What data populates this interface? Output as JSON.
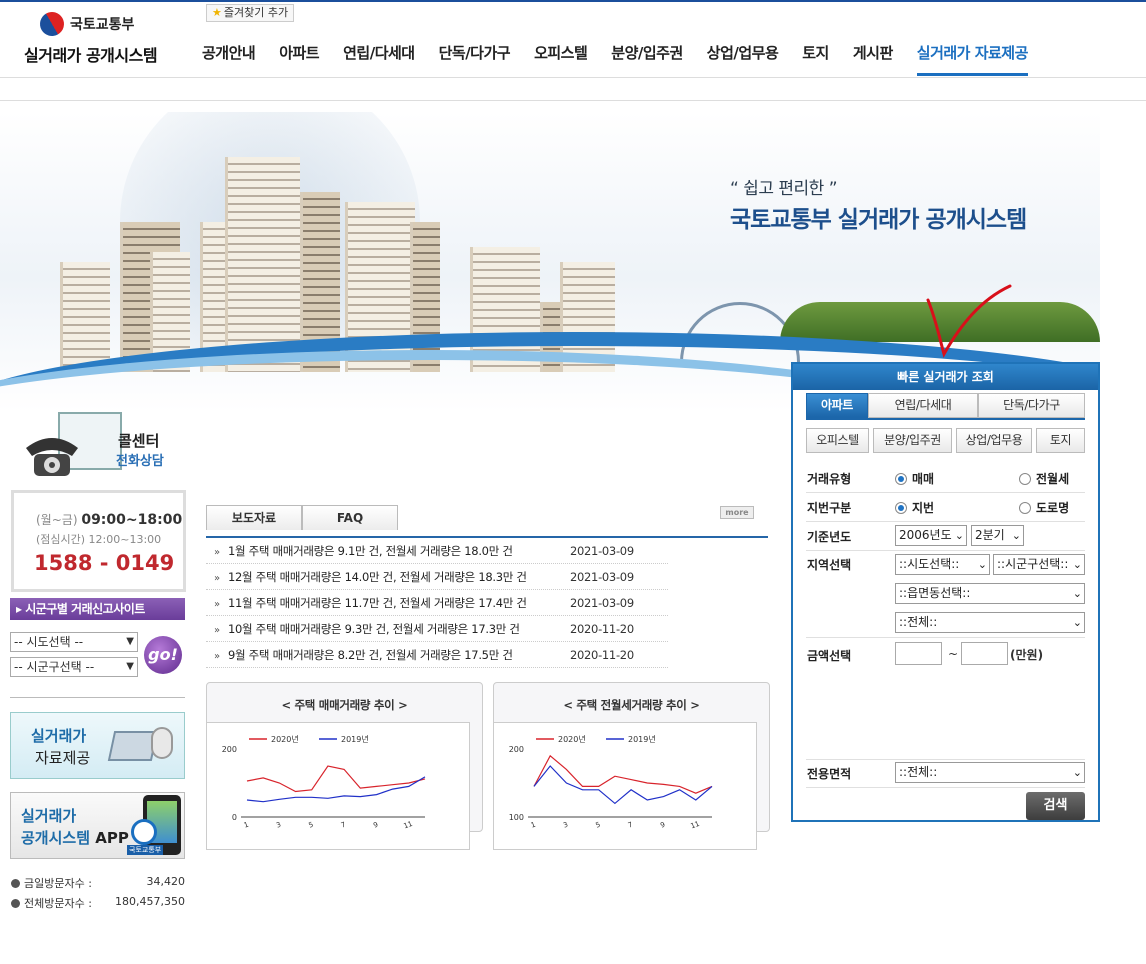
{
  "header": {
    "bookmark": "즐겨찾기 추가",
    "ministry": "국토교통부",
    "site_title": "실거래가 공개시스템",
    "nav": [
      "공개안내",
      "아파트",
      "연립/다세대",
      "단독/다가구",
      "오피스텔",
      "분양/입주권",
      "상업/업무용",
      "토지",
      "게시판",
      "실거래가 자료제공"
    ],
    "active_nav": "실거래가 자료제공"
  },
  "hero": {
    "slogan_small": "“ 쉽고 편리한 ”",
    "slogan_big": "국토교통부 실거래가 공개시스템"
  },
  "callcenter": {
    "title": "콜센터",
    "subtitle": "전화상담",
    "hours_label": "(월~금)",
    "hours": "09:00~18:00",
    "lunch": "(점심시간) 12:00~13:00",
    "phone": "1588 - 0149"
  },
  "site_finder": {
    "header": "▸ 시군구별 거래신고사이트",
    "sido_placeholder": "-- 시도선택 --",
    "sigungu_placeholder": "-- 시군구선택 --",
    "go_label": "go!"
  },
  "banners": {
    "data_title1": "실거래가",
    "data_title2": "자료제공",
    "app_title1": "실거래가",
    "app_title2": "공개시스템",
    "app_suffix": "APP",
    "app_logo_text": "국토교통부"
  },
  "visitors": {
    "today_label": "금일방문자수 :",
    "today_value": "34,420",
    "total_label": "전체방문자수 :",
    "total_value": "180,457,350"
  },
  "news": {
    "tabs": [
      "보도자료",
      "FAQ"
    ],
    "more_label": "more",
    "items": [
      {
        "title": "1월 주택 매매거래량은 9.1만 건, 전월세 거래량은 18.0만 건",
        "date": "2021-03-09"
      },
      {
        "title": "12월 주택 매매거래량은 14.0만 건, 전월세 거래량은 18.3만 건",
        "date": "2021-03-09"
      },
      {
        "title": "11월 주택 매매거래량은 11.7만 건, 전월세 거래량은 17.4만 건",
        "date": "2021-03-09"
      },
      {
        "title": "10월 주택 매매거래량은 9.3만 건, 전월세 거래량은 17.3만 건",
        "date": "2020-11-20"
      },
      {
        "title": "9월 주택 매매거래량은 8.2만 건, 전월세 거래량은 17.5만 건",
        "date": "2020-11-20"
      }
    ]
  },
  "colors": {
    "accent": "#1f73b8",
    "series_2020": "#d8242c",
    "series_2019": "#2030c8",
    "phone": "#c0282e"
  },
  "chart_data": [
    {
      "type": "line",
      "title": "< 주택 매매거래량 추이 >",
      "x": [
        1,
        2,
        3,
        4,
        5,
        6,
        7,
        8,
        9,
        10,
        11,
        12
      ],
      "x_ticks": [
        1,
        3,
        5,
        7,
        9,
        11
      ],
      "y_ticks": [
        0,
        200
      ],
      "ylim": [
        0,
        200
      ],
      "legend": "top",
      "series": [
        {
          "name": "2020년",
          "values": [
            106,
            115,
            100,
            75,
            80,
            150,
            140,
            85,
            90,
            95,
            100,
            112
          ]
        },
        {
          "name": "2019년",
          "values": [
            50,
            45,
            52,
            58,
            58,
            55,
            62,
            60,
            66,
            82,
            90,
            118
          ]
        }
      ]
    },
    {
      "type": "line",
      "title": "< 주택 전월세거래량 추이 >",
      "x": [
        1,
        2,
        3,
        4,
        5,
        6,
        7,
        8,
        9,
        10,
        11,
        12
      ],
      "x_ticks": [
        1,
        3,
        5,
        7,
        9,
        11
      ],
      "y_ticks": [
        100,
        200
      ],
      "ylim": [
        100,
        200
      ],
      "legend": "top",
      "series": [
        {
          "name": "2020년",
          "values": [
            145,
            190,
            170,
            145,
            145,
            160,
            155,
            150,
            148,
            145,
            135,
            145
          ]
        },
        {
          "name": "2019년",
          "values": [
            145,
            175,
            150,
            140,
            140,
            120,
            140,
            125,
            130,
            140,
            125,
            145
          ]
        }
      ]
    }
  ],
  "quick_search": {
    "title": "빠른 실거래가 조회",
    "tabs_row1": [
      "아파트",
      "연립/다세대",
      "단독/다가구"
    ],
    "tabs_row2": [
      "오피스텔",
      "분양/입주권",
      "상업/업무용",
      "토지"
    ],
    "active_tab": "아파트",
    "deal_type_label": "거래유형",
    "deal_options": [
      "매매",
      "전월세"
    ],
    "addr_type_label": "지번구분",
    "addr_options": [
      "지번",
      "도로명"
    ],
    "year_label": "기준년도",
    "year_value": "2006년도",
    "quarter_value": "2분기",
    "region_label": "지역선택",
    "sido_value": "::시도선택::",
    "sigungu_value": "::시군구선택::",
    "dong_value": "::읍면동선택::",
    "all_value": "::전체::",
    "price_label": "금액선택",
    "price_sep": "~",
    "price_unit": "(만원)",
    "area_label": "전용면적",
    "area_value": "::전체::",
    "search_label": "검색"
  }
}
